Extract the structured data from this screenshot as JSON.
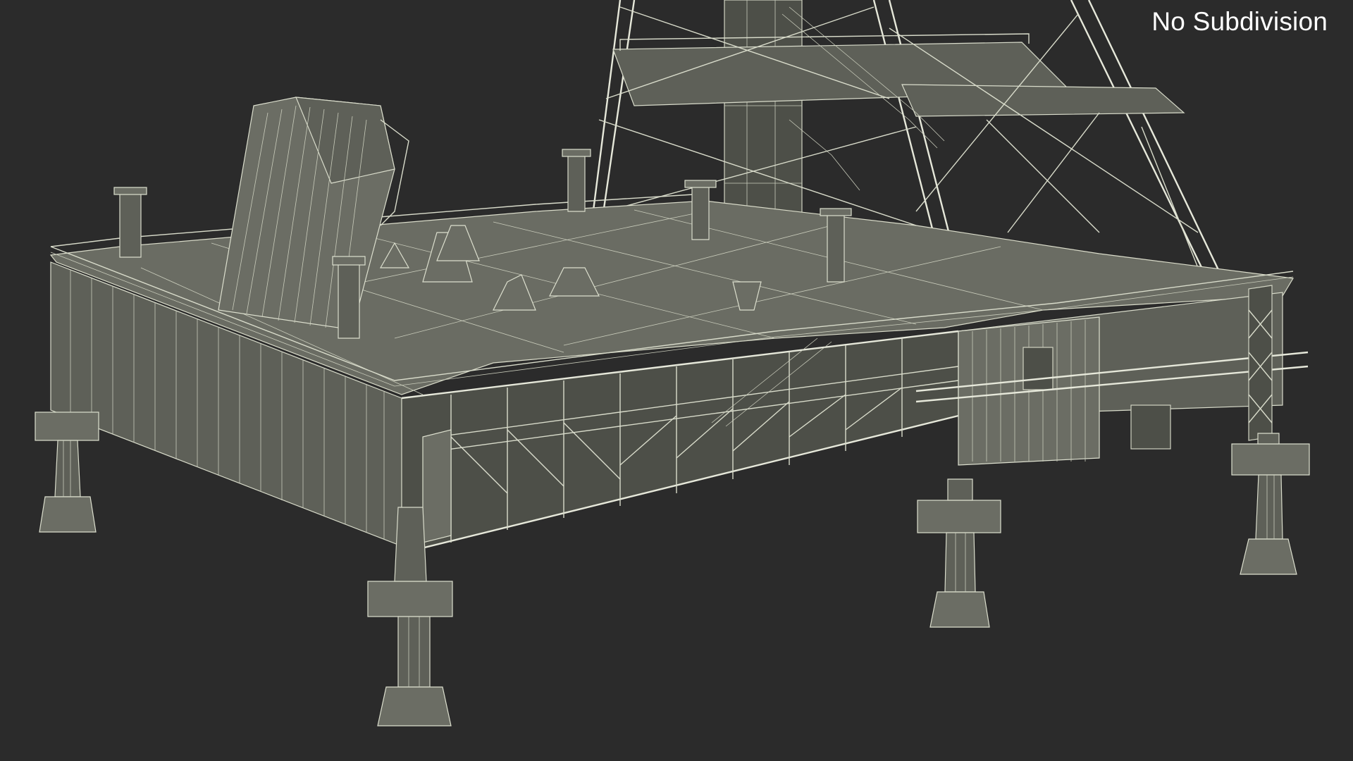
{
  "viewport": {
    "subdivision_label": "No Subdivision",
    "background_color": "#2b2b2b",
    "wire_color": "#d9dccb"
  }
}
